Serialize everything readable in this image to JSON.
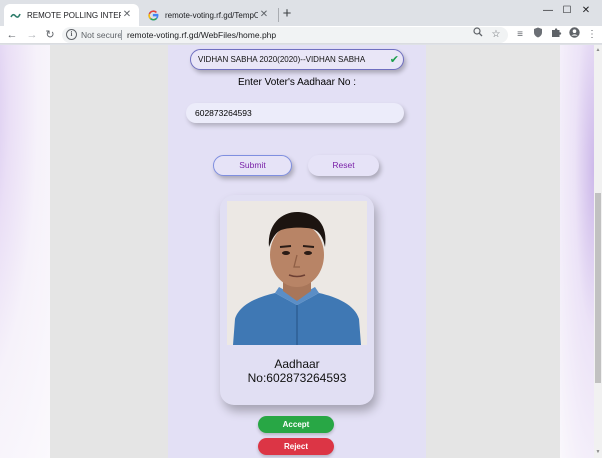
{
  "browser": {
    "tabs": [
      {
        "title": "REMOTE POLLING INTERFACE",
        "active": true,
        "favicon": "wave-icon"
      },
      {
        "title": "remote-voting.rf.gd/TempOtp.ph",
        "active": false,
        "favicon": "google-g-icon"
      }
    ],
    "new_tab_label": "+",
    "window_controls": {
      "minimize": "—",
      "maximize": "☐",
      "close": "✕"
    },
    "address_bar": {
      "security_label": "Not secure",
      "url": "remote-voting.rf.gd/WebFiles/home.php"
    }
  },
  "page": {
    "election_select": {
      "value": "VIDHAN SABHA 2020(2020)--VIDHAN SABHA",
      "status_icon": "checkmark-icon"
    },
    "voter_aadhaar_label": "Enter Voter's Aadhaar No :",
    "aadhaar_input_value": "602873264593",
    "submit_label": "Submit",
    "reset_label": "Reset",
    "voter_card": {
      "caption_line1": "Aadhaar",
      "caption_line2": "No:602873264593"
    },
    "accept_label": "Accept",
    "reject_label": "Reject"
  },
  "colors": {
    "accept": "#28a745",
    "reject": "#dc3545",
    "panel": "#e3e0f5",
    "button_text": "#7a22a8"
  }
}
